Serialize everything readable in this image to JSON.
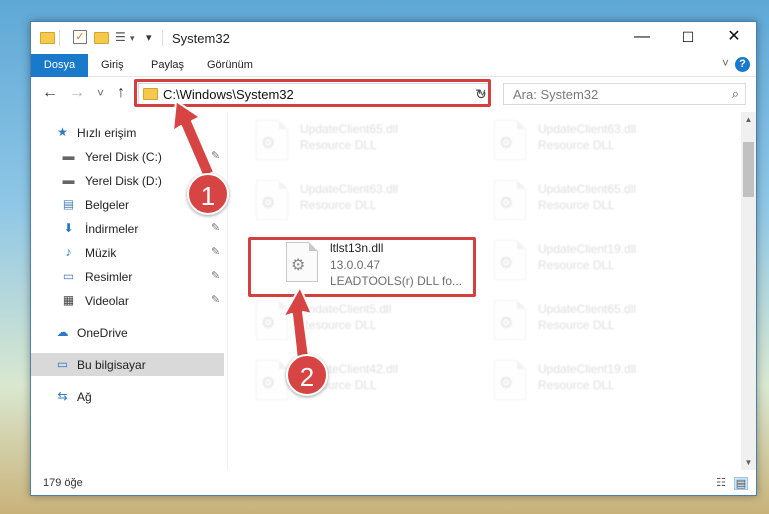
{
  "window": {
    "title": "System32",
    "controls": {
      "minimize": "—",
      "maximize": "☐",
      "close": "✕"
    },
    "qat": {
      "properties_icon": "checklist-icon",
      "newfolder_icon": "folder-icon",
      "customize": "▾"
    }
  },
  "ribbon": {
    "tabs": [
      "Dosya",
      "Giriş",
      "Paylaş",
      "Görünüm"
    ],
    "active_tab": "Dosya",
    "accent": "#1979ca",
    "help": "?"
  },
  "address": {
    "path": "C:\\Windows\\System32",
    "search_placeholder": "Ara: System32",
    "back": "←",
    "forward": "→",
    "recent": "˅",
    "up": "↑",
    "refresh": "↻"
  },
  "sidebar": {
    "items": [
      {
        "label": "Hızlı erişim",
        "icon": "star-icon",
        "glyph": "★",
        "pinned": false
      },
      {
        "label": "Yerel Disk (C:)",
        "icon": "drive-icon",
        "glyph": "▬",
        "pinned": true
      },
      {
        "label": "Yerel Disk (D:)",
        "icon": "drive-icon",
        "glyph": "▬",
        "pinned": true
      },
      {
        "label": "Belgeler",
        "icon": "documents-icon",
        "glyph": "▤",
        "pinned": true
      },
      {
        "label": "İndirmeler",
        "icon": "download-icon",
        "glyph": "⬇",
        "pinned": true
      },
      {
        "label": "Müzik",
        "icon": "music-icon",
        "glyph": "♪",
        "pinned": true
      },
      {
        "label": "Resimler",
        "icon": "pictures-icon",
        "glyph": "▭",
        "pinned": true
      },
      {
        "label": "Videolar",
        "icon": "video-icon",
        "glyph": "▦",
        "pinned": true
      },
      {
        "label": "OneDrive",
        "icon": "cloud-icon",
        "glyph": "☁",
        "pinned": false
      },
      {
        "label": "Bu bilgisayar",
        "icon": "computer-icon",
        "glyph": "▭",
        "pinned": false
      },
      {
        "label": "Ağ",
        "icon": "network-icon",
        "glyph": "⇆",
        "pinned": false
      }
    ],
    "pin_glyph": "📌",
    "selected": "Bu bilgisayar"
  },
  "files": [
    {
      "name": "UpdateClient65.dll",
      "desc": "Resource DLL",
      "faded": true
    },
    {
      "name": "UpdateClient63.dll",
      "desc": "Resource DLL",
      "faded": true
    },
    {
      "name": "UpdateClient63.dll",
      "desc": "Resource DLL",
      "faded": true
    },
    {
      "name": "UpdateClient65.dll",
      "desc": "Resource DLL",
      "faded": true
    },
    {
      "name": "ltlst13n.dll",
      "version": "13.0.0.47",
      "desc": "LEADTOOLS(r) DLL fo...",
      "faded": false
    },
    {
      "name": "UpdateClient19.dll",
      "desc": "Resource DLL",
      "faded": true
    },
    {
      "name": "UpdateClient5.dll",
      "desc": "Resource DLL",
      "faded": true
    },
    {
      "name": "UpdateClient65.dll",
      "desc": "Resource DLL",
      "faded": true
    },
    {
      "name": "UpdateClient42.dll",
      "desc": "Resource DLL",
      "faded": true
    },
    {
      "name": "UpdateClient19.dll",
      "desc": "Resource DLL",
      "faded": true
    }
  ],
  "status": {
    "count": "179 öğe"
  },
  "annotations": {
    "badge1": "1",
    "badge2": "2",
    "color": "#d64543"
  }
}
